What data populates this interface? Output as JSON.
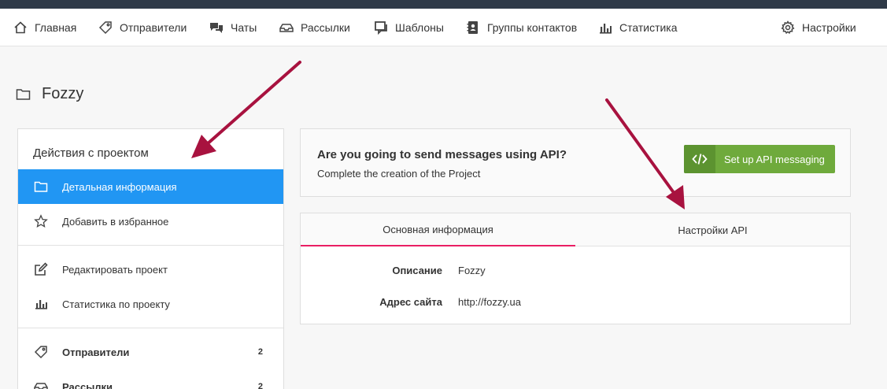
{
  "nav": {
    "items": [
      {
        "label": "Главная",
        "icon": "home-icon"
      },
      {
        "label": "Отправители",
        "icon": "tag-icon"
      },
      {
        "label": "Чаты",
        "icon": "chat-icon"
      },
      {
        "label": "Рассылки",
        "icon": "inbox-icon"
      },
      {
        "label": "Шаблоны",
        "icon": "template-icon"
      },
      {
        "label": "Группы контактов",
        "icon": "contacts-icon"
      },
      {
        "label": "Статистика",
        "icon": "stats-icon"
      }
    ],
    "settings": {
      "label": "Настройки",
      "icon": "gear-icon"
    }
  },
  "page": {
    "title": "Fozzy",
    "icon": "folder-icon"
  },
  "sidebar": {
    "heading": "Действия с проектом",
    "items": [
      {
        "label": "Детальная информация",
        "icon": "folder-icon",
        "active": true
      },
      {
        "label": "Добавить в избранное",
        "icon": "star-icon"
      },
      {
        "label": "Редактировать проект",
        "icon": "edit-icon"
      },
      {
        "label": "Статистика по проекту",
        "icon": "stats-icon"
      },
      {
        "label": "Отправители",
        "icon": "tag-icon",
        "count": "2"
      },
      {
        "label": "Рассылки",
        "icon": "inbox-icon",
        "count": "2"
      }
    ]
  },
  "api_prompt": {
    "question": "Are you going to send messages using API?",
    "subtitle": "Complete the creation of the Project",
    "button_label": "Set up API messaging",
    "button_icon": "code-icon"
  },
  "info": {
    "tabs": [
      {
        "label": "Основная информация",
        "active": true
      },
      {
        "label": "Настройки API"
      }
    ],
    "rows": [
      {
        "label": "Описание",
        "value": "Fozzy"
      },
      {
        "label": "Адрес сайта",
        "value": "http://fozzy.ua"
      }
    ]
  },
  "colors": {
    "accent_blue": "#2196f3",
    "button_green": "#6faa3c",
    "tab_underline": "#e91e63",
    "annotation_arrow": "#a8123f"
  }
}
